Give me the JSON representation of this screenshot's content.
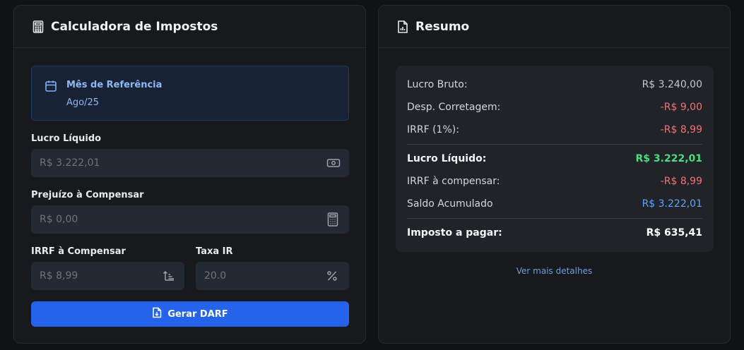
{
  "calculator": {
    "title": "Calculadora de Impostos",
    "icon": "calculator-icon",
    "reference": {
      "label": "Mês de Referência",
      "value": "Ago/25",
      "icon": "calendar-icon"
    },
    "fields": {
      "lucro_liquido": {
        "label": "Lucro Líquido",
        "placeholder": "R$ 3.222,01",
        "icon": "banknote-icon"
      },
      "prejuizo": {
        "label": "Prejuízo à Compensar",
        "placeholder": "R$ 0,00",
        "icon": "calculator-icon"
      },
      "irrf": {
        "label": "IRRF à Compensar",
        "placeholder": "R$ 8,99",
        "icon": "sort-ascending-icon"
      },
      "taxa_ir": {
        "label": "Taxa IR",
        "placeholder": "20.0",
        "icon": "percent-icon"
      }
    },
    "button": {
      "label": "Gerar DARF",
      "icon": "file-download-icon"
    }
  },
  "summary": {
    "title": "Resumo",
    "icon": "file-chart-icon",
    "rows": [
      {
        "label": "Lucro Bruto:",
        "value": "R$ 3.240,00",
        "color": "#c4c8ce"
      },
      {
        "label": "Desp. Corretagem:",
        "value": "-R$ 9,00",
        "color": "#f87171"
      },
      {
        "label": "IRRF (1%):",
        "value": "-R$ 8,99",
        "color": "#f87171"
      },
      {
        "label": "Lucro Líquido:",
        "value": "R$ 3.222,01",
        "color": "#4ade80"
      },
      {
        "label": "IRRF à compensar:",
        "value": "-R$ 8,99",
        "color": "#f87171"
      },
      {
        "label": "Saldo Acumulado",
        "value": "R$ 3.222,01",
        "color": "#60a5fa"
      },
      {
        "label": "Imposto a pagar:",
        "value": "R$ 635,41",
        "color": "#ffffff"
      }
    ],
    "link": "Ver mais detalhes"
  }
}
